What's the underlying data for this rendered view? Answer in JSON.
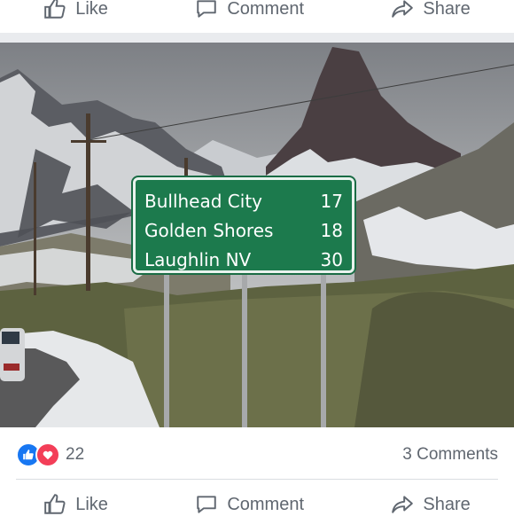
{
  "top_actions": {
    "like": "Like",
    "comment": "Comment",
    "share": "Share"
  },
  "photo": {
    "sign": [
      {
        "place": "Bullhead City",
        "miles": "17"
      },
      {
        "place": "Golden Shores",
        "miles": "18"
      },
      {
        "place": "Laughlin NV",
        "miles": "30"
      }
    ]
  },
  "reactions": {
    "count": "22",
    "comments": "3 Comments",
    "icons": [
      "like-icon",
      "love-icon"
    ]
  },
  "bottom_actions": {
    "like": "Like",
    "comment": "Comment",
    "share": "Share"
  }
}
